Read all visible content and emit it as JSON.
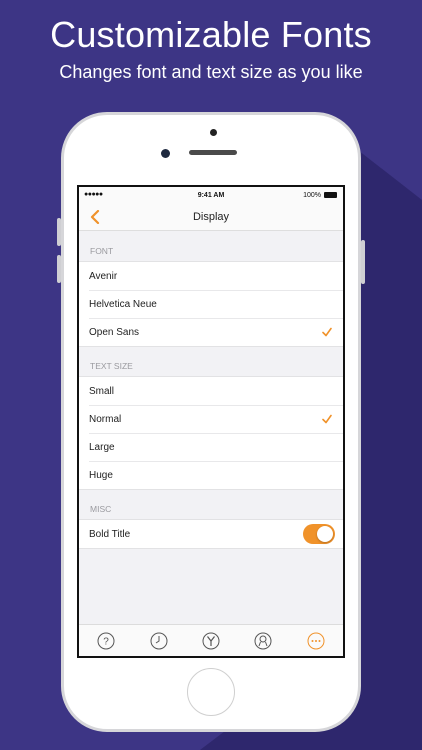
{
  "promo": {
    "headline": "Customizable Fonts",
    "subhead": "Changes font and text size as you like"
  },
  "colors": {
    "background": "#3d3585",
    "accent": "#f0922a"
  },
  "status_bar": {
    "signal": "●●●●●",
    "time": "9:41 AM",
    "battery": "100%"
  },
  "nav": {
    "back_icon": "chevron-left-icon",
    "title": "Display"
  },
  "sections": {
    "font": {
      "header": "FONT",
      "items": [
        {
          "label": "Avenir",
          "selected": false
        },
        {
          "label": "Helvetica Neue",
          "selected": false
        },
        {
          "label": "Open Sans",
          "selected": true
        }
      ]
    },
    "text_size": {
      "header": "TEXT SIZE",
      "items": [
        {
          "label": "Small",
          "selected": false
        },
        {
          "label": "Normal",
          "selected": true
        },
        {
          "label": "Large",
          "selected": false
        },
        {
          "label": "Huge",
          "selected": false
        }
      ]
    },
    "misc": {
      "header": "MISC",
      "items": [
        {
          "label": "Bold Title",
          "toggle_on": true
        }
      ]
    }
  },
  "tabbar": {
    "tabs": [
      {
        "icon": "question-icon"
      },
      {
        "icon": "clock-icon"
      },
      {
        "icon": "y-combinator-icon"
      },
      {
        "icon": "user-icon"
      },
      {
        "icon": "more-icon",
        "active": true
      }
    ]
  }
}
